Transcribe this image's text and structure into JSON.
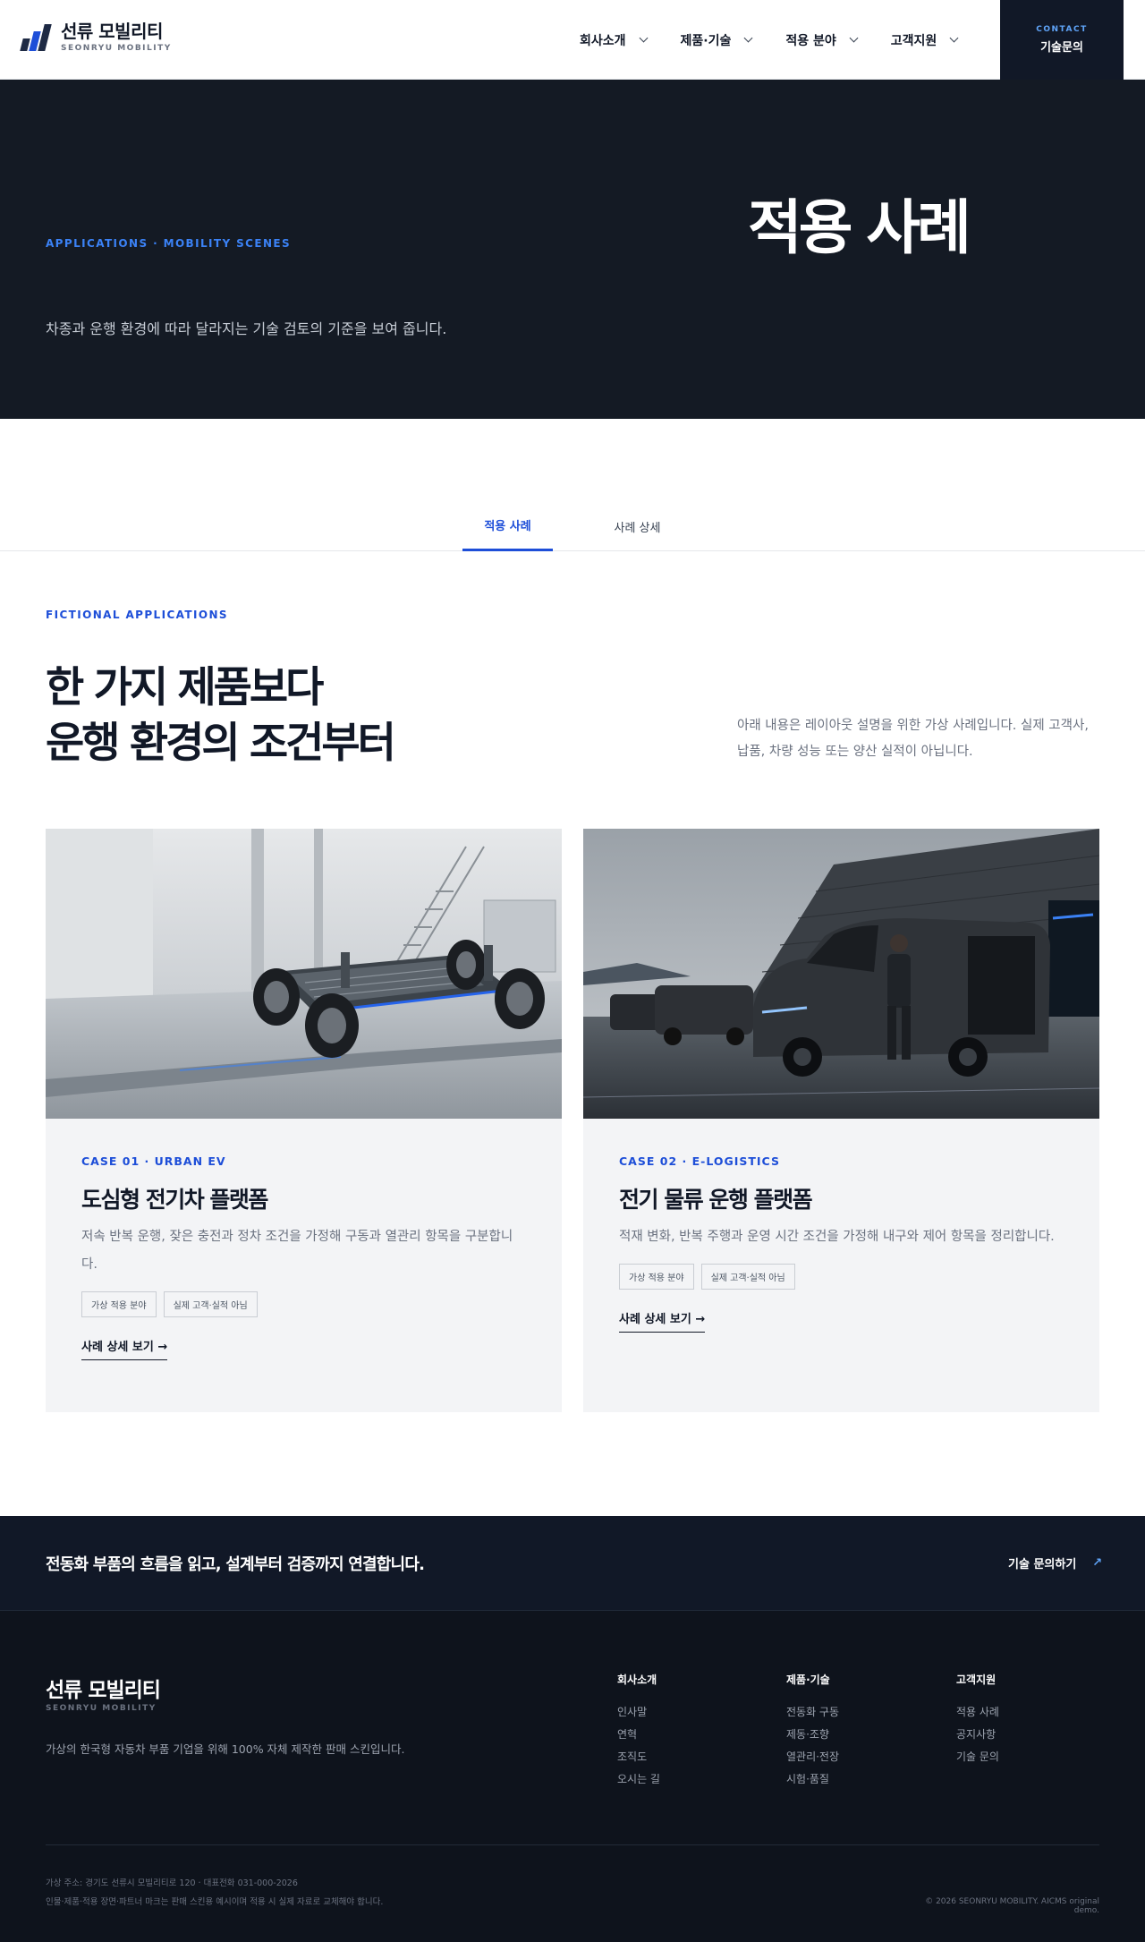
{
  "header": {
    "logo_ko": "선류 모빌리티",
    "logo_en": "SEONRYU MOBILITY",
    "nav": [
      "회사소개",
      "제품·기술",
      "적용 분야",
      "고객지원"
    ],
    "contact_small": "CONTACT",
    "contact_big": "기술문의"
  },
  "hero": {
    "eyebrow": "APPLICATIONS · MOBILITY SCENES",
    "title": "적용 사례",
    "description": "차종과 운행 환경에 따라 달라지는 기술 검토의 기준을 보여 줍니다."
  },
  "tabs": [
    "적용 사례",
    "사례 상세"
  ],
  "intro": {
    "eyebrow": "FICTIONAL APPLICATIONS",
    "title_line1": "한 가지 제품보다",
    "title_line2": "운행 환경의 조건부터",
    "note": "아래 내용은 레이아웃 설명을 위한 가상 사례입니다. 실제 고객사, 납품, 차량 성능 또는 양산 실적이 아닙니다."
  },
  "cards": [
    {
      "label": "CASE 01 · URBAN EV",
      "title": "도심형 전기차 플랫폼",
      "description": "저속 반복 운행, 잦은 충전과 정차 조건을 가정해 구동과 열관리 항목을 구분합니다.",
      "tags": [
        "가상 적용 분야",
        "실제 고객·실적 아님"
      ],
      "link": "사례 상세 보기 →"
    },
    {
      "label": "CASE 02 · E-LOGISTICS",
      "title": "전기 물류 운행 플랫폼",
      "description": "적재 변화, 반복 주행과 운영 시간 조건을 가정해 내구와 제어 항목을 정리합니다.",
      "tags": [
        "가상 적용 분야",
        "실제 고객·실적 아님"
      ],
      "link": "사례 상세 보기 →"
    }
  ],
  "cta": {
    "text": "전동화 부품의 흐름을 읽고, 설계부터 검증까지 연결합니다.",
    "link": "기술 문의하기",
    "arrow": "↗"
  },
  "footer": {
    "logo_ko": "선류 모빌리티",
    "logo_en": "SEONRYU MOBILITY",
    "description": "가상의 한국형 자동차 부품 기업을 위해 100% 자체 제작한 판매 스킨입니다.",
    "columns": [
      {
        "head": "회사소개",
        "links": [
          "인사말",
          "연혁",
          "조직도",
          "오시는 길"
        ]
      },
      {
        "head": "제품·기술",
        "links": [
          "전동화 구동",
          "제동·조향",
          "열관리·전장",
          "시험·품질"
        ]
      },
      {
        "head": "고객지원",
        "links": [
          "적용 사례",
          "공지사항",
          "기술 문의"
        ]
      }
    ],
    "address": "가상 주소: 경기도 선류시 모빌리티로 120 · 대표전화 031-000-2026",
    "legal": "인물·제품·적용 장면·파트너 마크는 판매 스킨용 예시이며 적용 시 실제 자료로 교체해야 합니다.",
    "copyright": "© 2026 SEONRYU MOBILITY. AICMS original demo."
  },
  "colors": {
    "accent": "#1d4ed8",
    "dark": "#141a24",
    "footer": "#0e131c",
    "card_bg": "#f3f4f6"
  }
}
